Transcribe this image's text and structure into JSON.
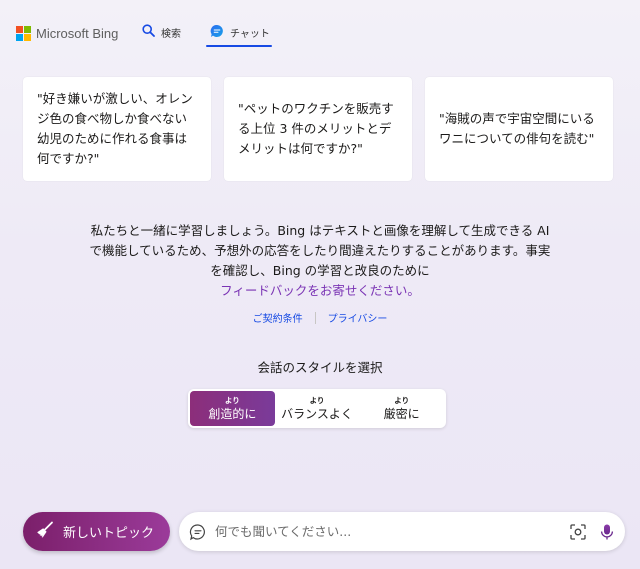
{
  "header": {
    "brand": "Microsoft Bing",
    "nav_search": "検索",
    "nav_chat": "チャット"
  },
  "suggestions": [
    "\"好き嫌いが激しい、オレンジ色の食べ物しか食べない幼児のために作れる食事は何ですか?\"",
    "\"ペットのワクチンを販売する上位 3 件のメリットとデメリットは何ですか?\"",
    "\"海賊の声で宇宙空間にいるワニについての俳句を読む\""
  ],
  "info": {
    "text": "私たちと一緒に学習しましょう。Bing はテキストと画像を理解して生成できる AI で機能しているため、予想外の応答をしたり間違えたりすることがあります。事実を確認し、Bing の学習と改良のために",
    "feedback_link": "フィードバックをお寄せください。"
  },
  "links": {
    "terms": "ご契約条件",
    "privacy": "プライバシー"
  },
  "style": {
    "title": "会話のスタイルを選択",
    "options": [
      {
        "small": "より",
        "label": "創造的に",
        "selected": true
      },
      {
        "small": "より",
        "label": "バランスよく",
        "selected": false
      },
      {
        "small": "より",
        "label": "厳密に",
        "selected": false
      }
    ]
  },
  "bottom": {
    "new_topic": "新しいトピック",
    "input_placeholder": "何でも聞いてください...",
    "input_value": ""
  },
  "colors": {
    "accent_blue": "#174ae4",
    "creative_purple": "#8c2e7a",
    "feedback_purple": "#7a33b4"
  },
  "icons": {
    "search": "search-icon",
    "chat": "chat-bubble-icon",
    "broom": "broom-icon",
    "chat_input": "chat-input-icon",
    "visual_search": "visual-search-icon",
    "mic": "microphone-icon"
  }
}
